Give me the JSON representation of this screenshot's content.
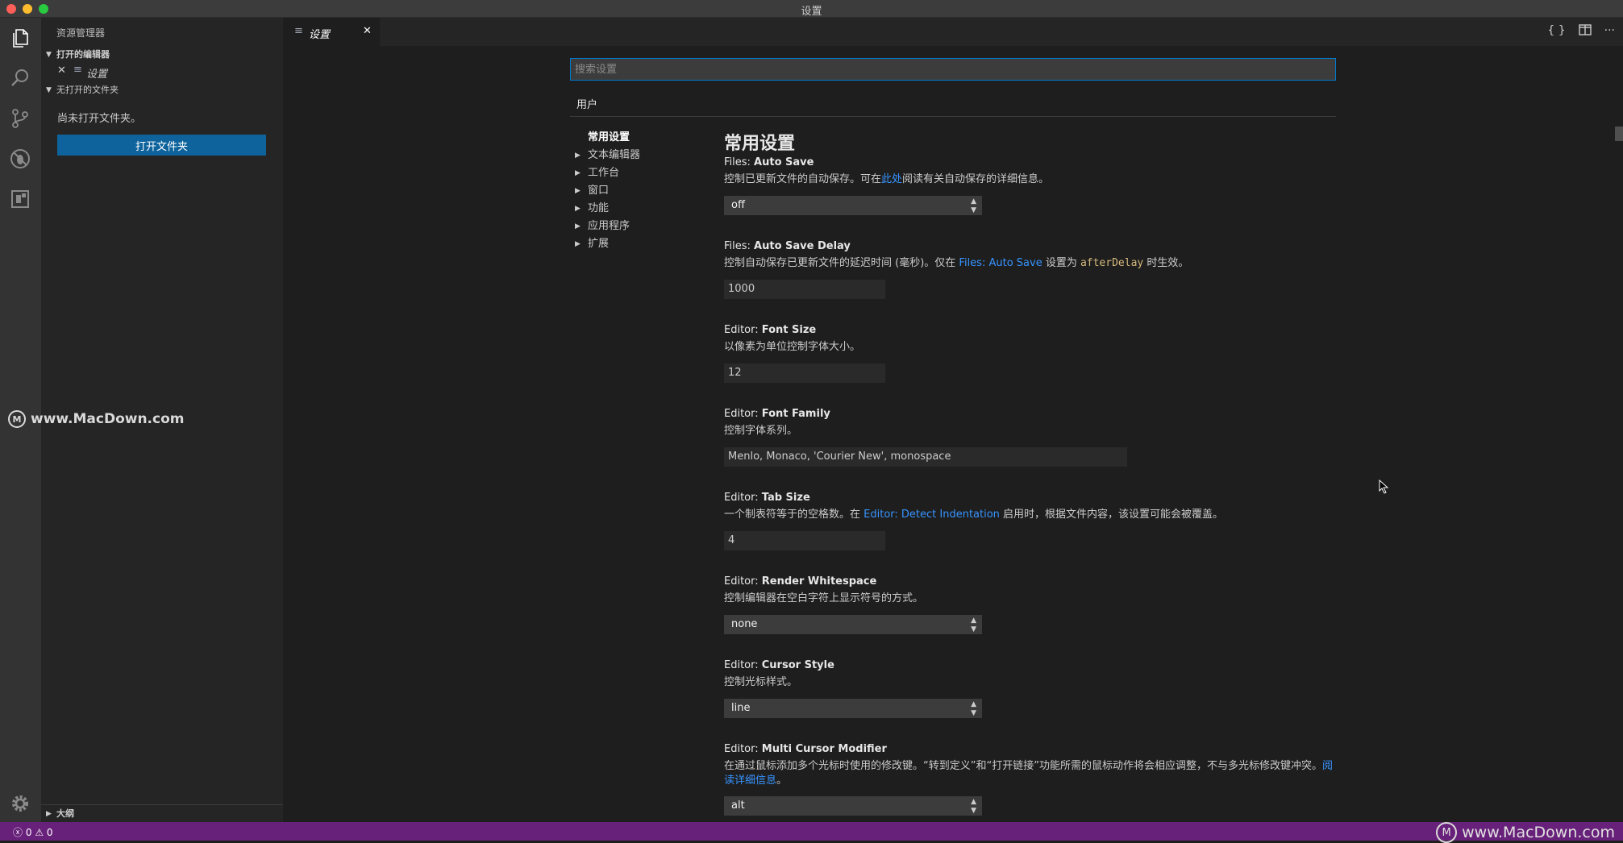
{
  "window": {
    "title": "设置"
  },
  "colors": {
    "accent": "#007acc",
    "button": "#0e639c",
    "statusbar": "#68217a",
    "link": "#3794ff"
  },
  "activity_bar": {
    "items": [
      "files-icon",
      "search-icon",
      "source-control-icon",
      "debug-icon",
      "extensions-icon"
    ],
    "bottom": "gear-icon"
  },
  "sidebar": {
    "title": "资源管理器",
    "open_editors": {
      "label": "打开的编辑器",
      "items": [
        {
          "label": "设置"
        }
      ]
    },
    "no_folder": {
      "label": "无打开的文件夹",
      "message": "尚未打开文件夹。",
      "button": "打开文件夹"
    },
    "outline": {
      "label": "大纲"
    }
  },
  "tabs": [
    {
      "label": "设置"
    }
  ],
  "tab_actions": [
    "{ }",
    "split",
    "···"
  ],
  "settings": {
    "search_placeholder": "搜索设置",
    "scope_tab": "用户",
    "toc": [
      {
        "label": "常用设置",
        "active": true
      },
      {
        "label": "文本编辑器"
      },
      {
        "label": "工作台"
      },
      {
        "label": "窗口"
      },
      {
        "label": "功能"
      },
      {
        "label": "应用程序"
      },
      {
        "label": "扩展"
      }
    ],
    "section_title": "常用设置",
    "items": {
      "auto_save": {
        "category": "Files: ",
        "name": "Auto Save",
        "desc_a": "控制已更新文件的自动保存。可在",
        "desc_link": "此处",
        "desc_b": "阅读有关自动保存的详细信息。",
        "value": "off"
      },
      "auto_save_delay": {
        "category": "Files: ",
        "name": "Auto Save Delay",
        "desc_a": "控制自动保存已更新文件的延迟时间 (毫秒)。仅在 ",
        "desc_link": "Files: Auto Save",
        "desc_b": " 设置为 ",
        "desc_code": "afterDelay",
        "desc_c": " 时生效。",
        "value": "1000"
      },
      "font_size": {
        "category": "Editor: ",
        "name": "Font Size",
        "desc": "以像素为单位控制字体大小。",
        "value": "12"
      },
      "font_family": {
        "category": "Editor: ",
        "name": "Font Family",
        "desc": "控制字体系列。",
        "value": "Menlo, Monaco, 'Courier New', monospace"
      },
      "tab_size": {
        "category": "Editor: ",
        "name": "Tab Size",
        "desc_a": "一个制表符等于的空格数。在 ",
        "desc_link": "Editor: Detect Indentation",
        "desc_b": " 启用时，根据文件内容，该设置可能会被覆盖。",
        "value": "4"
      },
      "render_whitespace": {
        "category": "Editor: ",
        "name": "Render Whitespace",
        "desc": "控制编辑器在空白字符上显示符号的方式。",
        "value": "none"
      },
      "cursor_style": {
        "category": "Editor: ",
        "name": "Cursor Style",
        "desc": "控制光标样式。",
        "value": "line"
      },
      "multi_cursor": {
        "category": "Editor: ",
        "name": "Multi Cursor Modifier",
        "desc_a": "在通过鼠标添加多个光标时使用的修改键。“转到定义”和“打开链接”功能所需的鼠标动作将会相应调整，不与多光标修改键冲突。",
        "desc_link": "阅读详细信息",
        "desc_b": "。",
        "value": "alt"
      }
    }
  },
  "statusbar": {
    "errors": "0",
    "warnings": "0"
  },
  "watermark": "www.MacDown.com"
}
